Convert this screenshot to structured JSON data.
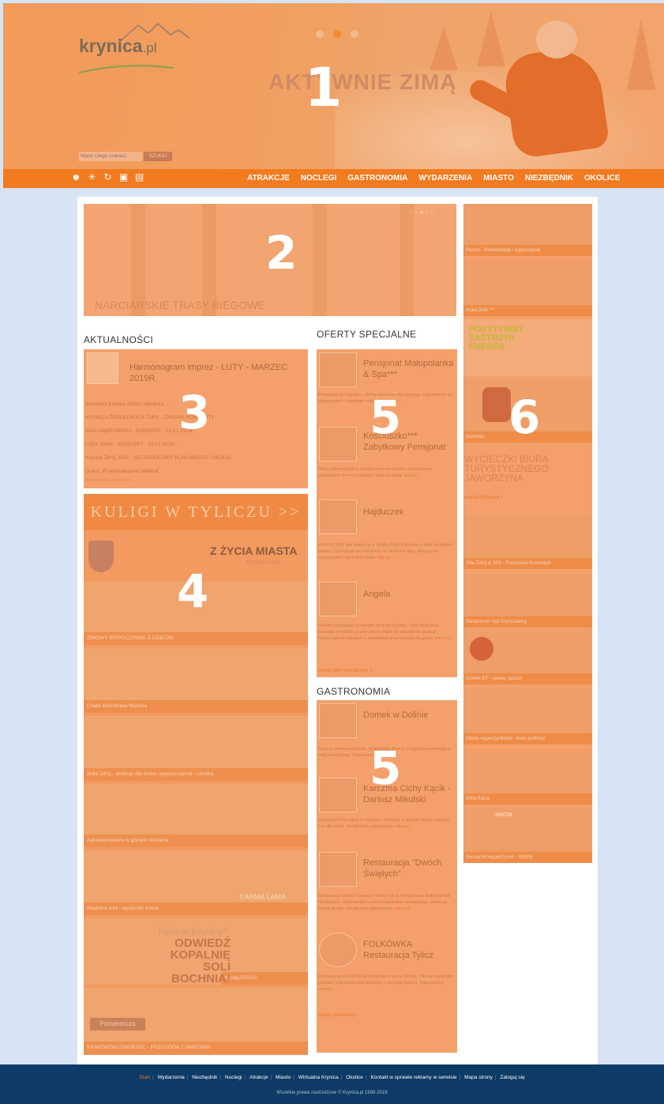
{
  "colors": {
    "accent": "#f27a1f",
    "overlay": "#f4a06a",
    "footer_bg": "#0d3a66",
    "page_bg": "#d6e4f3"
  },
  "header": {
    "logo_name": "krynica",
    "logo_tld": ".pl",
    "hero_title": "AKTYWNIE ZIMĄ",
    "search": {
      "placeholder": "Wpisz czego szukasz...",
      "button": "SZUKAJ"
    },
    "icons": [
      "user-icon",
      "weather-icon",
      "refresh-icon",
      "camera-icon",
      "image-icon"
    ],
    "menu": [
      "ATRAKCJE",
      "NOCLEGI",
      "GASTRONOMIA",
      "WYDARZENIA",
      "MIASTO",
      "NIEZBĘDNIK",
      "OKOLICE"
    ]
  },
  "overlays": [
    "1",
    "2",
    "3",
    "4",
    "5",
    "5",
    "6"
  ],
  "banner": {
    "caption": "NARCIARSKIE TRASY BIEGOWE",
    "pager": "○○●○○"
  },
  "news": {
    "heading": "AKTUALNOŚCI",
    "title": "Harmonogram imprez - LUTY - MARZEC 2019R.",
    "lines": [
      "Burmistrz Krynicy-Zdroju zaprasza...",
      "KRYNICA ŹRÓDŁEM KULTURY - ZIMOWE KONCERTY",
      "ANIA DĄBROWSKA - KONCERT - 23.02.2019r.",
      "LADY PANK - KONCERT - 23.02.2019r.",
      "Krynica-Zdrój 2018 - SZCZEGÓŁOWY PLAN MIASTA I OKOLIC",
      "Quest „W poszukiwaniu Nikifora”"
    ],
    "more": "więcej aktualności »"
  },
  "ads": {
    "kuligi": "KULIGI W TYLICZU >>",
    "zycie_title": "Z ŻYCIA MIASTA",
    "zycie_sub": "Krynica-Zdrój",
    "captions": [
      "ZIMOWY WYPOCZYNEK Z DZIEĆMI",
      "Chata Wierchowa Wysoka",
      "Willa Zdrój - atrakcje dla dzieci, wypożyczalnia i szkółka",
      "Zakwaterowanie w górskim klimacie",
      "Stadnina koni i wycieczki konne",
      "Wyciąg PEKAO",
      "KRAKOWSKI DWORZEC - PRZYGODA Z NARCIAMI"
    ],
    "farma_label": "FARMA LAMA",
    "bochnia_line1": "Ferie w Krynicy?",
    "bochnia_line2": "ODWIEDŹ KOPALNIĘ SOLI BOCHNIA!",
    "pomaranczowa": "Pomarańcza"
  },
  "offers": {
    "heading": "OFERTY SPECJALNE",
    "items": [
      {
        "title": "Pensjonat Małopolanka & Spa***",
        "desc": "Pensjonat na Deptaku - oferta specjalna dla każdego, zaproszenie na wypoczynek i wspaniałe zabiegi...",
        "more": "więcej »"
      },
      {
        "title": "Kościuszko*** Zabytkowy Pensjonat",
        "desc": "Willa położona jest w ścisłym centrum Krynicy. Komfortowe wypoczęcie w sercu miasta z dużą atrakcją.",
        "more": "więcej »"
      },
      {
        "title": "Hajduczek",
        "desc": "HAJDUCZEK jest położony w środku Góry Parkowej z dala od zgiełku i hałasu, z przepięknym widokiem na okoliczne lasy. Miejsce na wypoczynek i spokojny relaks.",
        "more": "więcej »"
      },
      {
        "title": "Angela",
        "desc": "Obiekt usytuowany w samym centrum Krynicy. Taka lokalizacja pozwala w krótkim czasie pieszo dojść do wszystkich atrakcji. Dysponujemy pokojami z łazienkami oraz kuchnią dla gości.",
        "more": "więcej »"
      }
    ],
    "more": "więcej ofert specjalnych »"
  },
  "gastro": {
    "heading": "GASTRONOMIA",
    "items": [
      {
        "title": "Domek w Dolinie",
        "desc": "Pyszna domowa kuchnia, wyśmienite desery, z wyjątkową obsługą w miłej atmosferze. Zapraszamy!",
        "more": "więcej »"
      },
      {
        "title": "Karczma Cichy Kącik - Dariusz Mikulski",
        "desc": "Karczma Cichy Kącik to miejsce z tradycją, w którym każdy znajdzie coś dla siebie. Serdecznie zapraszamy.",
        "more": "więcej »"
      },
      {
        "title": "Restauracja \"Dwóch Świętych\"",
        "desc": "Restauracja Dwóch Świętych mieści się w Pensjonacie Małopolanka na Deptaku. Wyśmienita kuchnia regionalna i europejska, oferta na każdą okazję. Serdecznie zapraszamy.",
        "more": "więcej »"
      },
      {
        "title": "FOLKÓWKA Restauracja Tylicz",
        "desc": "Restauracja FOLKÓWKA położona w sercu Tylicza. Oferuje tradycyjne potrawy regionalne oraz wieczory z muzyką ludową. Zapraszamy!",
        "more": "więcej »"
      }
    ],
    "more": "więcej restauracji »"
  },
  "sidebar": {
    "captions": [
      "Resort - Rehabilitacja i wypoczynek",
      "Hotel Orlik ***",
      "Gondola",
      "Villa Zdrój & SPA - Pracownia Kosmetyki",
      "Sanatorium nad Kryniczanką",
      "Domek BT - sauna, jacuzzi",
      "Oferta wypoczynkowa - biuro podróży",
      "Willa Kama",
      "Narciarski wypoczynek - SNOW"
    ],
    "pozytywny": "POZYTYWNY ZASTRZYK ENERGII",
    "biuro": "WYCIECZKI BIURA TURYSTYCZNEGO JAWORZYNA",
    "biuro_more": "więcej informacji »",
    "snow_label": "SNOW"
  },
  "footer": {
    "links": [
      "Start",
      "Wydarzenia",
      "Niezbędnik",
      "Noclegi",
      "Atrakcje",
      "Miasto",
      "Wirtualna Krynica",
      "Okolice",
      "Kontakt w sprawie reklamy w serwisie",
      "Mapa strony",
      "Zaloguj się"
    ],
    "copyright": "Wszelkie prawa zastrzeżone © Krynica.pl 1998-2019"
  }
}
